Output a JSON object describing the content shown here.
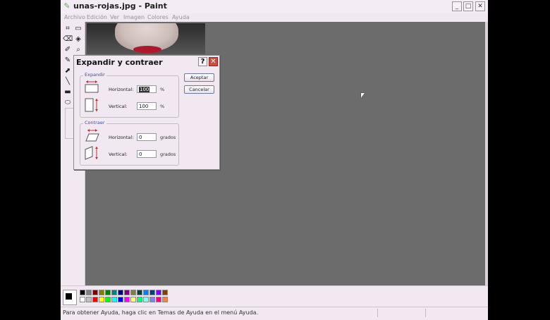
{
  "window": {
    "title": "unas-rojas.jpg - Paint",
    "controls": {
      "minimize": "_",
      "maximize": "□",
      "close": "✕"
    }
  },
  "menu": {
    "items": [
      "Archivo",
      "Edición",
      "Ver",
      "Imagen",
      "Colores",
      "Ayuda"
    ]
  },
  "tools": [
    "free-select",
    "rect-select",
    "eraser",
    "fill",
    "color-picker",
    "magnifier",
    "pencil",
    "brush",
    "airbrush",
    "text",
    "line",
    "curve",
    "rectangle",
    "polygon",
    "ellipse",
    "rounded-rect"
  ],
  "dialog": {
    "title": "Expandir y contraer",
    "help": "?",
    "close": "✕",
    "expand": {
      "label": "Expandir",
      "horizontal_label": "Horizontal:",
      "horizontal_value": "100",
      "horizontal_unit": "%",
      "vertical_label": "Vertical:",
      "vertical_value": "100",
      "vertical_unit": "%"
    },
    "skew": {
      "label": "Contraer",
      "horizontal_label": "Horizontal:",
      "horizontal_value": "0",
      "horizontal_unit": "grados",
      "vertical_label": "Vertical:",
      "vertical_value": "0",
      "vertical_unit": "grados"
    },
    "ok_label": "Aceptar",
    "cancel_label": "Cancelar"
  },
  "palette": {
    "top": [
      "#000000",
      "#808080",
      "#800000",
      "#808000",
      "#008000",
      "#008080",
      "#000080",
      "#800080",
      "#808040",
      "#004040",
      "#0080ff",
      "#004080",
      "#8000ff",
      "#804000"
    ],
    "bottom": [
      "#ffffff",
      "#c0c0c0",
      "#ff0000",
      "#ffff00",
      "#00ff00",
      "#00ffff",
      "#0000ff",
      "#ff00ff",
      "#ffff80",
      "#00ff80",
      "#80ffff",
      "#8080ff",
      "#ff0080",
      "#ff8040"
    ]
  },
  "status": {
    "text": "Para obtener Ayuda, haga clic en Temas de Ayuda en el menú Ayuda."
  }
}
